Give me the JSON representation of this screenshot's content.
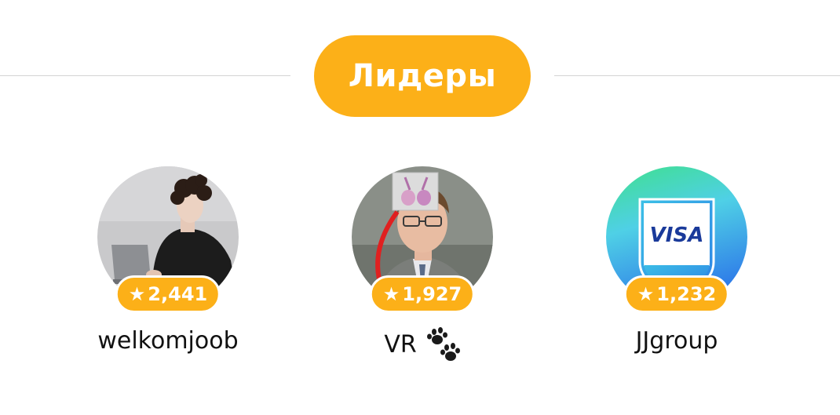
{
  "header": {
    "title": "Лидеры"
  },
  "leaders": [
    {
      "name": "welkomjoob",
      "score": "2,441",
      "avatar": "person-with-laptop"
    },
    {
      "name": "VR",
      "score": "1,927",
      "avatar": "man-with-glasses",
      "badge_icon": "paw-prints-icon"
    },
    {
      "name": "JJgroup",
      "score": "1,232",
      "avatar": "visa-shield-logo",
      "logo_text": "VISA"
    }
  ],
  "colors": {
    "accent": "#fcb018",
    "divider": "#d4d4d4",
    "text": "#111111"
  }
}
